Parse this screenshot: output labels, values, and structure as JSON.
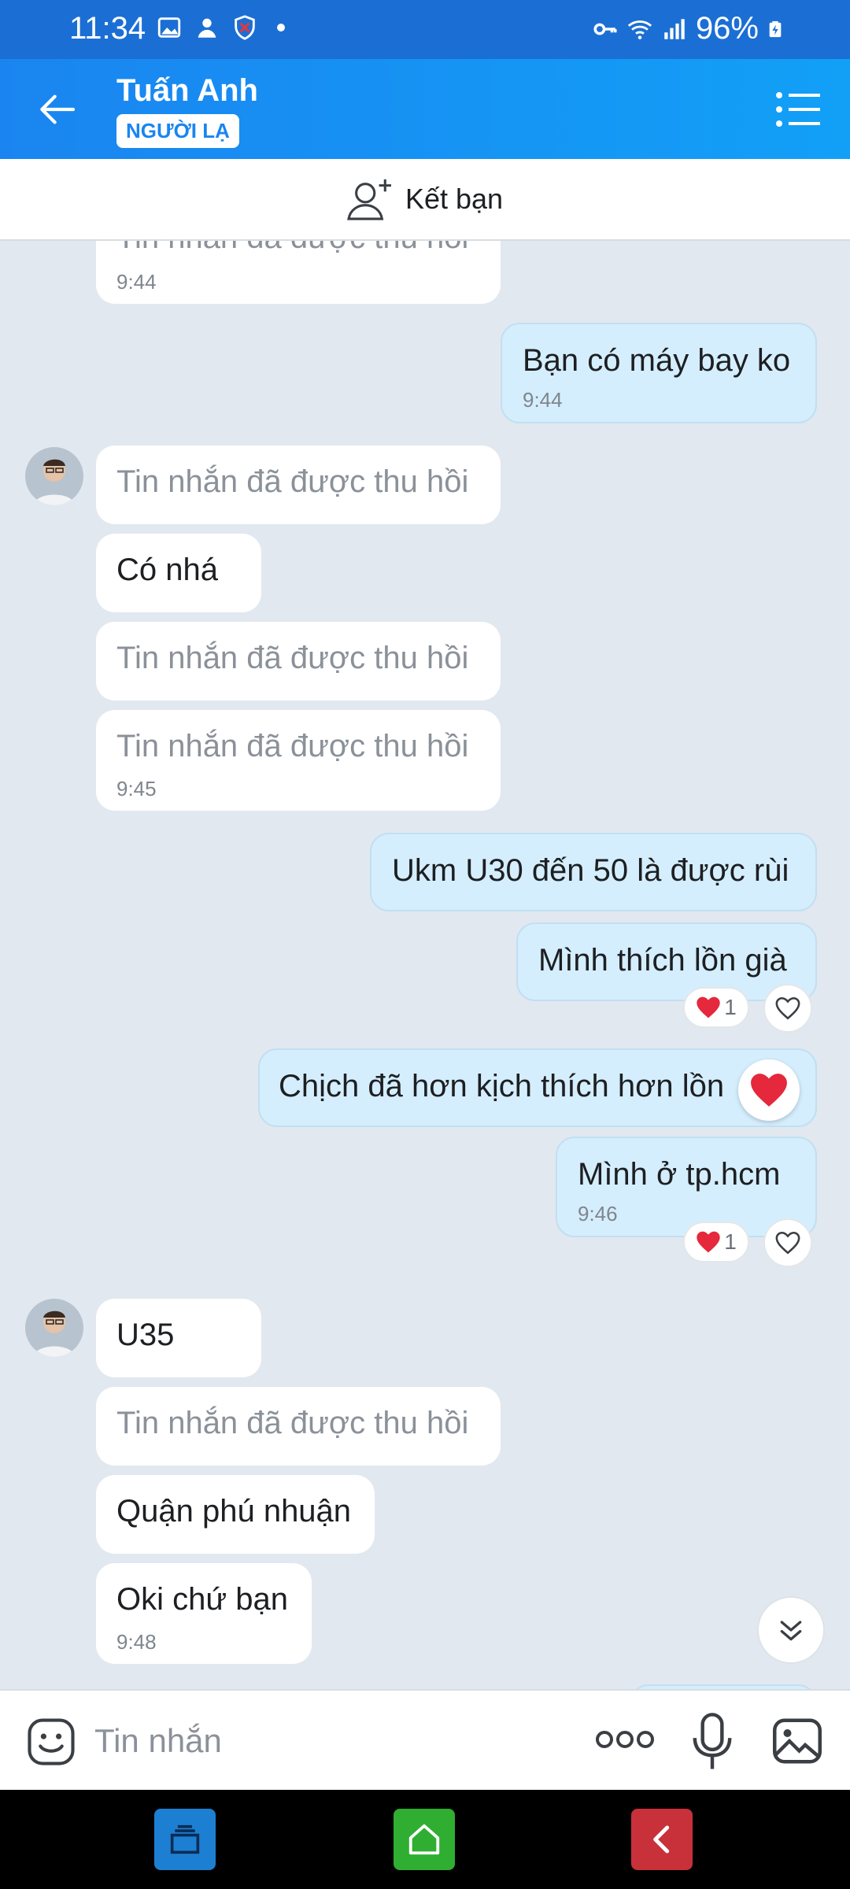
{
  "status": {
    "time": "11:34",
    "battery": "96%"
  },
  "header": {
    "name": "Tuấn Anh",
    "badge": "NGƯỜI LẠ"
  },
  "addfriend": {
    "label": "Kết bạn"
  },
  "messages": [
    {
      "text": "Tin nhắn đã được thu hồi",
      "time": "9:44"
    },
    {
      "text": "Bạn có máy bay ko",
      "time": "9:44"
    },
    {
      "text": "Tin nhắn đã được thu hồi"
    },
    {
      "text": "Có nhá"
    },
    {
      "text": "Tin nhắn đã được thu hồi"
    },
    {
      "text": "Tin nhắn đã được thu hồi",
      "time": "9:45"
    },
    {
      "text": "Ukm U30 đến 50 là được rùi"
    },
    {
      "text": "Mình thích lồn già",
      "reaction_count": "1"
    },
    {
      "text": "Chịch đã hơn kịch thích hơn lồn"
    },
    {
      "text": "Mình ở tp.hcm",
      "time": "9:46",
      "reaction_count": "1"
    },
    {
      "text": "U35"
    },
    {
      "text": "Tin nhắn đã được thu hồi"
    },
    {
      "text": "Quận phú nhuận"
    },
    {
      "text": "Oki chứ bạn",
      "time": "9:48"
    }
  ],
  "input": {
    "placeholder": "Tin nhắn"
  },
  "colors": {
    "header": "#1a85f0",
    "outgoing": "#d5eefd",
    "incoming": "#ffffff",
    "background": "#e2e8ef"
  }
}
